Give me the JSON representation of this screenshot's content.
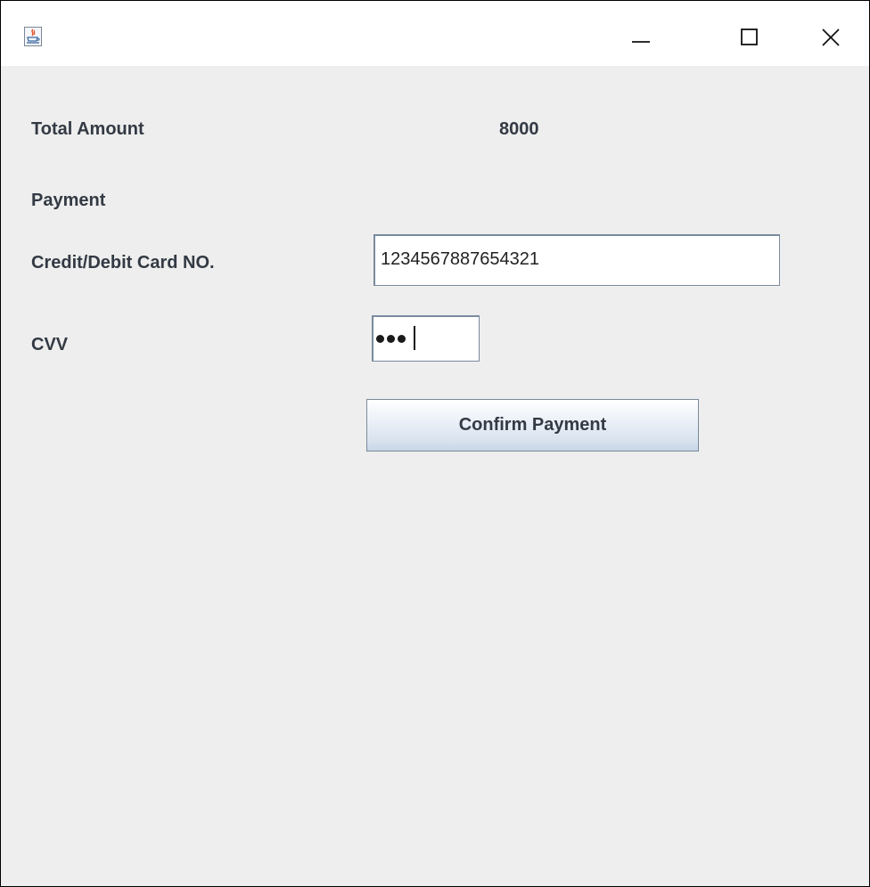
{
  "window": {
    "title": "",
    "controls": {
      "minimize": "minimize-icon",
      "maximize": "maximize-icon",
      "close": "close-icon"
    },
    "app_icon": "java-cup-icon"
  },
  "form": {
    "total_amount_label": "Total Amount",
    "total_amount_value": "8000",
    "payment_label": "Payment",
    "card_label": "Credit/Debit Card NO.",
    "card_value": "1234567887654321",
    "cvv_label": "CVV",
    "cvv_masked_length": 3,
    "confirm_button": "Confirm Payment"
  },
  "colors": {
    "background": "#eeeeee",
    "titlebar": "#ffffff",
    "label_text": "#333a44",
    "field_border": "#7a8a9e"
  }
}
